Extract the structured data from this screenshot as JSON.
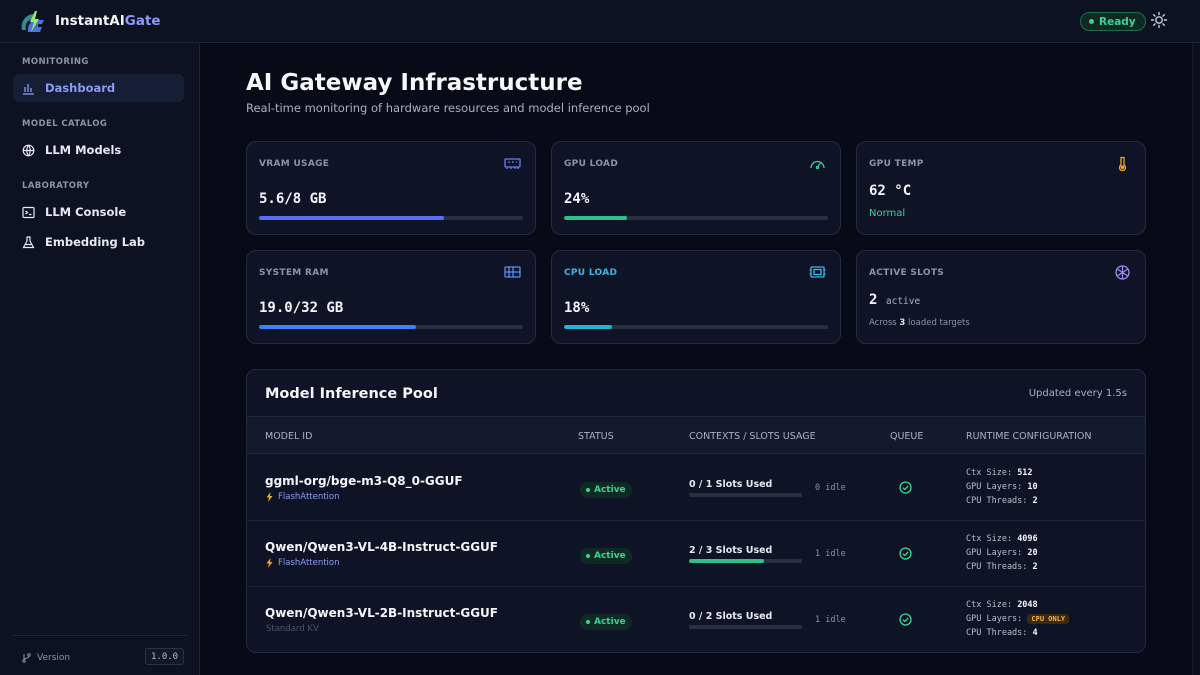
{
  "app": {
    "name_main": "InstantAI",
    "name_accent": "Gate",
    "status": "Ready"
  },
  "sidebar": {
    "sections": [
      {
        "label": "MONITORING"
      },
      {
        "label": "MODEL CATALOG"
      },
      {
        "label": "LABORATORY"
      }
    ],
    "items": [
      {
        "label": "Dashboard",
        "icon": "bar-chart-icon",
        "active": true
      },
      {
        "label": "LLM Models",
        "icon": "globe-icon"
      },
      {
        "label": "LLM Console",
        "icon": "terminal-icon"
      },
      {
        "label": "Embedding Lab",
        "icon": "flask-icon"
      }
    ],
    "version_label": "Version",
    "version": "1.0.0"
  },
  "header": {
    "title": "AI Gateway Infrastructure",
    "subtitle": "Real-time monitoring of hardware resources and model inference pool"
  },
  "cards": [
    {
      "label": "VRAM USAGE",
      "value": "5.6/8 GB",
      "progress": 0.7,
      "bar_color": "#5b6cf0",
      "icon": "memory-chip-icon",
      "icon_color": "#6b7cf5"
    },
    {
      "label": "GPU LOAD",
      "value": "24%",
      "progress": 0.24,
      "bar_color": "#2fbf8a",
      "icon": "gauge-icon",
      "icon_color": "#38d399"
    },
    {
      "label": "GPU TEMP",
      "value": "62 °C",
      "note": "Normal",
      "icon": "thermometer-icon",
      "icon_color": "#f5a524"
    },
    {
      "label": "SYSTEM RAM",
      "value": "19.0/32 GB",
      "progress": 0.594,
      "bar_color": "#3b82f6",
      "icon": "ram-icon",
      "icon_color": "#5b8df5"
    },
    {
      "label": "CPU LOAD",
      "value": "18%",
      "progress": 0.18,
      "bar_color": "#22b3d9",
      "icon": "cpu-icon",
      "icon_color": "#3fb4e4"
    },
    {
      "label": "ACTIVE SLOTS",
      "value": "2",
      "value_suffix": "active",
      "note_pre": "Across",
      "note_count": "3",
      "note_post": "loaded targets",
      "icon": "network-icon",
      "icon_color": "#9b8cf5"
    }
  ],
  "pool": {
    "title": "Model Inference Pool",
    "updated": "Updated every 1.5s",
    "columns": [
      "MODEL ID",
      "STATUS",
      "CONTEXTS / SLOTS USAGE",
      "QUEUE",
      "RUNTIME CONFIGURATION"
    ],
    "rows": [
      {
        "model": "ggml-org/bge-m3-Q8_0-GGUF",
        "tag": "FlashAttention",
        "flash": true,
        "status": "Active",
        "slots": "0 / 1 Slots Used",
        "slots_fraction": 0,
        "idle": "0 idle",
        "ctx_label": "Ctx Size:",
        "ctx": "512",
        "gpu_label": "GPU Layers:",
        "gpu": "10",
        "cpu_label": "CPU Threads:",
        "cpu": "2"
      },
      {
        "model": "Qwen/Qwen3-VL-4B-Instruct-GGUF",
        "tag": "FlashAttention",
        "flash": true,
        "status": "Active",
        "slots": "2 / 3 Slots Used",
        "slots_fraction": 0.667,
        "idle": "1 idle",
        "ctx_label": "Ctx Size:",
        "ctx": "4096",
        "gpu_label": "GPU Layers:",
        "gpu": "20",
        "cpu_label": "CPU Threads:",
        "cpu": "2"
      },
      {
        "model": "Qwen/Qwen3-VL-2B-Instruct-GGUF",
        "tag": "Standard KV",
        "flash": false,
        "status": "Active",
        "slots": "0 / 2 Slots Used",
        "slots_fraction": 0,
        "idle": "1 idle",
        "ctx_label": "Ctx Size:",
        "ctx": "2048",
        "gpu_label": "GPU Layers:",
        "gpu": "CPU ONLY",
        "cpu_label": "CPU Threads:",
        "cpu": "4"
      }
    ]
  }
}
